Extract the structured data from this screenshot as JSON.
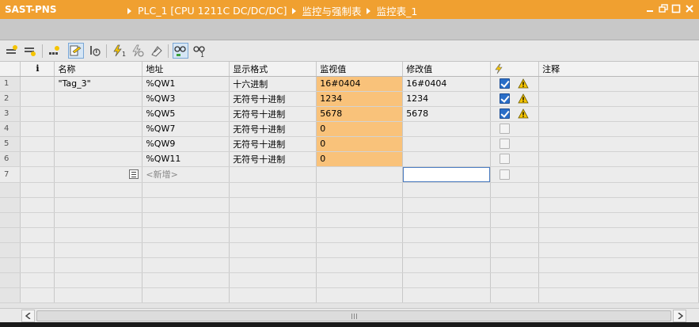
{
  "title": {
    "project": "SAST-PNS",
    "crumbs": [
      "PLC_1 [CPU 1211C DC/DC/DC]",
      "监控与强制表",
      "监控表_1"
    ]
  },
  "table": {
    "headers": {
      "info": "i",
      "name": "名称",
      "address": "地址",
      "format": "显示格式",
      "monitor": "监视值",
      "modify": "修改值",
      "comment": "注释"
    },
    "rows": [
      {
        "num": "1",
        "name": "\"Tag_3\"",
        "address": "%QW1",
        "format": "十六进制",
        "monitor": "16#0404",
        "modify": "16#0404",
        "checked": true,
        "warn": true
      },
      {
        "num": "2",
        "name": "",
        "address": "%QW3",
        "format": "无符号十进制",
        "monitor": "1234",
        "modify": "1234",
        "checked": true,
        "warn": true
      },
      {
        "num": "3",
        "name": "",
        "address": "%QW5",
        "format": "无符号十进制",
        "monitor": "5678",
        "modify": "5678",
        "checked": true,
        "warn": true
      },
      {
        "num": "4",
        "name": "",
        "address": "%QW7",
        "format": "无符号十进制",
        "monitor": "0",
        "modify": "",
        "checked": false,
        "warn": false
      },
      {
        "num": "5",
        "name": "",
        "address": "%QW9",
        "format": "无符号十进制",
        "monitor": "0",
        "modify": "",
        "checked": false,
        "warn": false
      },
      {
        "num": "6",
        "name": "",
        "address": "%QW11",
        "format": "无符号十进制",
        "monitor": "0",
        "modify": "",
        "checked": false,
        "warn": false
      }
    ],
    "new_row": {
      "num": "7",
      "label": "<新增>"
    }
  },
  "colors": {
    "titlebar": "#f0a030",
    "monitor_cell": "#f9c27a",
    "checkbox_on": "#2a6ec8",
    "warning": "#f5c400"
  },
  "icons": [
    "insert-row-icon",
    "add-row-icon",
    "show-all-modify-icon",
    "monitor-all-icon",
    "monitor-once-icon",
    "modify-now-icon",
    "modify-trigger-icon",
    "enable-peripheral-icon",
    "monitor-table-icon",
    "monitor-values-icon"
  ]
}
